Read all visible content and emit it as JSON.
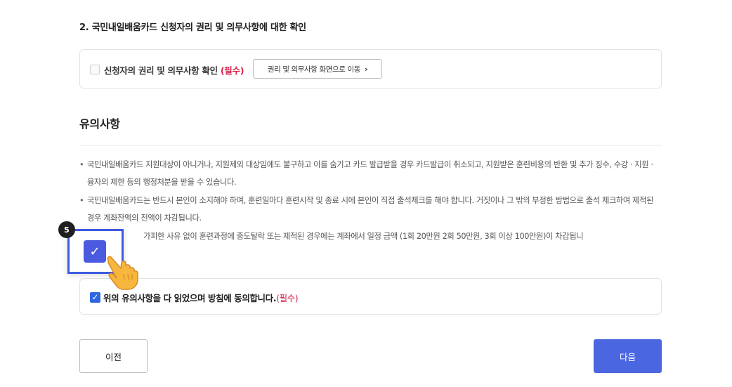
{
  "section": {
    "title": "2. 국민내일배움카드 신청자의 권리 및 의무사항에 대한 확인"
  },
  "rights": {
    "checkbox_label": "신청자의 권리 및 의무사항 확인",
    "required": "(필수)",
    "button_label": "권리 및 의무사항 화면으로 이동",
    "button_icon": "chevron-right-icon"
  },
  "notes": {
    "heading": "유의사항",
    "items": [
      "국민내일배움카드 지원대상이 아니거나, 지원제외 대상임에도 불구하고 이를 숨기고 카드 발급받을 경우 카드발급이 취소되고, 지원받은 훈련비용의 반환 및 추가 징수, 수강 · 지원 · 융자의 제한 등의 행정처분을 받을 수 있습니다.",
      "국민내일배움카드는 반드시 본인이 소지해야 하며, 훈련일마다 훈련시작 및 종료 시에 본인이 직접 출석체크를 해야 합니다. 거짓이나 그 밖의 부정한 방법으로 출석 체크하여 제적된 경우 계좌잔액의 전액이 차감됩니다.",
      "가피한 사유 없이 훈련과정에 중도탈락 또는 제적된 경우에는 계좌에서 일정 금액 (1회 20만원 2회 50만원, 3회 이상 100만원)이 차감됩니"
    ]
  },
  "agree": {
    "label": "위의 유의사항을 다 읽었으며 방침에 동의합니다.",
    "required": "(필수)",
    "checked": true
  },
  "buttons": {
    "prev": "이전",
    "next": "다음"
  },
  "tutorial": {
    "step": "5",
    "pointer_icon": "pointing-hand-icon"
  },
  "colors": {
    "accent": "#4a66e0",
    "required": "#d6224a",
    "focus_border": "#3f5be0"
  }
}
